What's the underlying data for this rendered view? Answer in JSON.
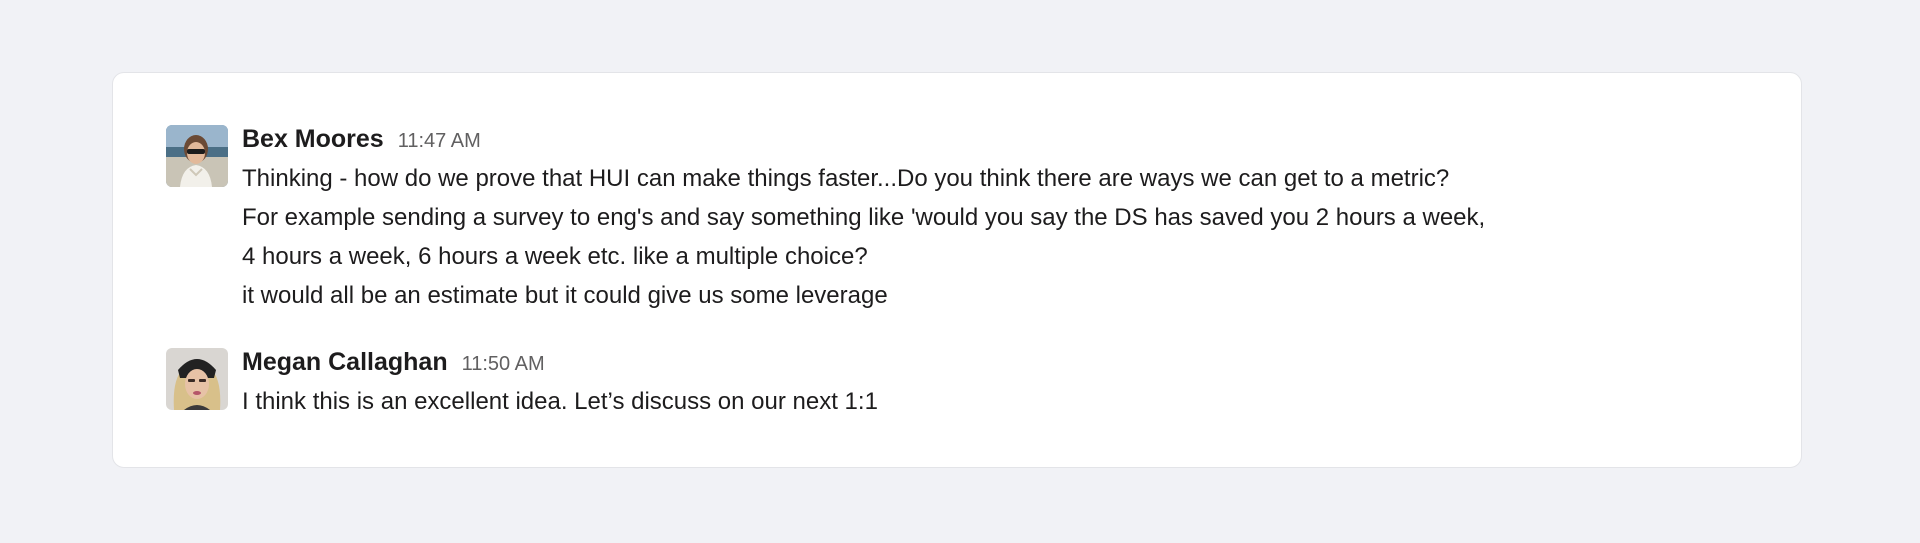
{
  "messages": [
    {
      "author": "Bex Moores",
      "time": "11:47 AM",
      "lines": [
        "Thinking - how do we prove that HUI can make things faster...Do you think there are ways we can get to a metric?",
        "For example sending a survey to eng's and say something like 'would you say the DS has saved you 2 hours a week,",
        " 4 hours a week, 6 hours a week etc. like a multiple choice?",
        " it would all be an estimate but it could give us some leverage"
      ]
    },
    {
      "author": "Megan Callaghan",
      "time": "11:50 AM",
      "lines": [
        "I think this is an excellent idea. Let’s discuss on our next 1:1"
      ]
    }
  ]
}
